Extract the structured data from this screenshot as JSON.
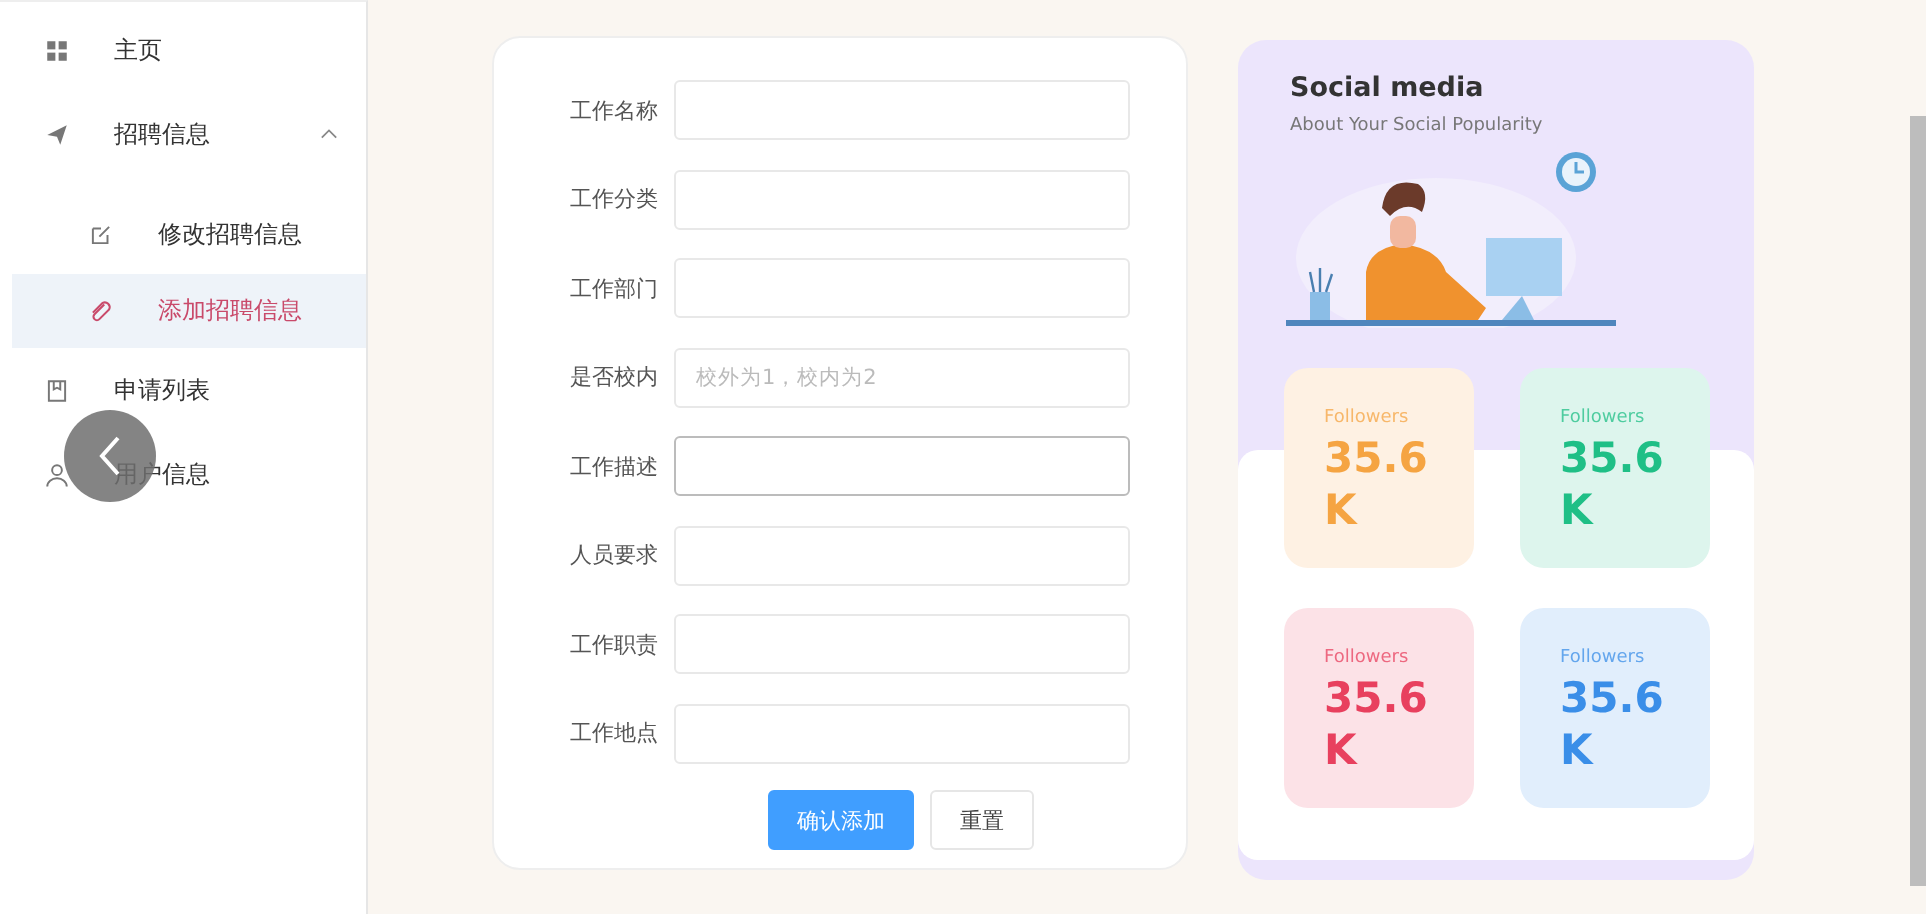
{
  "sidebar": {
    "items": [
      {
        "kind": "item",
        "label": "主页",
        "selected": false
      },
      {
        "kind": "group",
        "label": "招聘信息",
        "expanded": true,
        "children": [
          {
            "label": "修改招聘信息",
            "selected": false
          },
          {
            "label": "添加招聘信息",
            "selected": true
          }
        ]
      },
      {
        "kind": "item",
        "label": "申请列表",
        "selected": false
      },
      {
        "kind": "item",
        "label": "用户信息",
        "selected": false
      }
    ]
  },
  "form": {
    "fields": [
      {
        "label": "工作名称",
        "focused": false
      },
      {
        "label": "工作分类",
        "focused": false
      },
      {
        "label": "工作部门",
        "focused": false
      },
      {
        "label": "是否校内",
        "placeholder": "校外为1，校内为2",
        "focused": false
      },
      {
        "label": "工作描述",
        "focused": true
      },
      {
        "label": "人员要求",
        "focused": false
      },
      {
        "label": "工作职责",
        "focused": false
      },
      {
        "label": "工作地点",
        "focused": false
      }
    ],
    "buttons": [
      {
        "kind": "primary",
        "label": "确认添加"
      },
      {
        "kind": "default",
        "label": "重置"
      }
    ]
  },
  "social": {
    "title": "Social media",
    "subtitle": "About Your Social Popularity",
    "stats": [
      {
        "label": "Followers",
        "value": "35.6 K",
        "color": "#f5a442"
      },
      {
        "label": "Followers",
        "value": "35.6 K",
        "color": "#1fbf86"
      },
      {
        "label": "Followers",
        "value": "35.6 K",
        "color": "#e8405e"
      },
      {
        "label": "Followers",
        "value": "35.6 K",
        "color": "#3a8ee8"
      }
    ]
  }
}
